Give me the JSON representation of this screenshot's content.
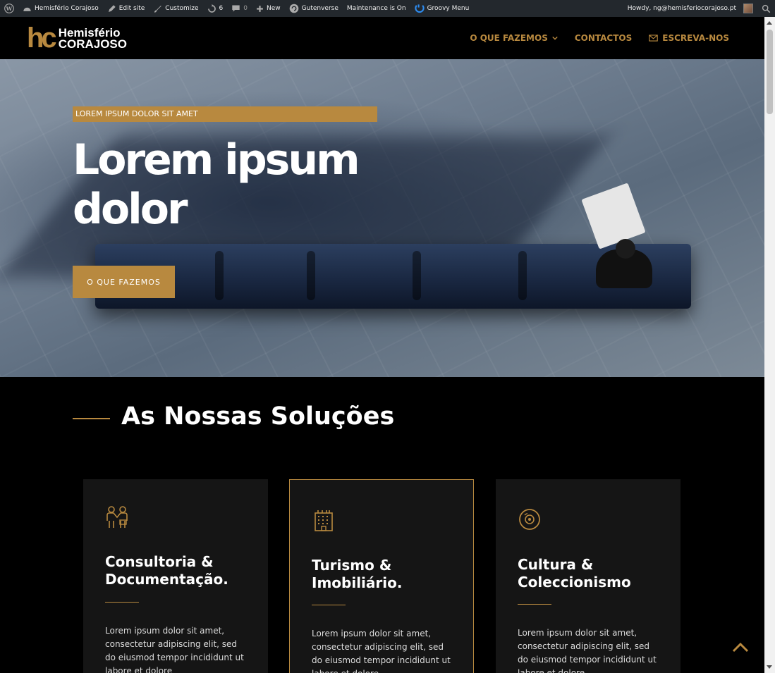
{
  "adminbar": {
    "site_name": "Hemisfério Corajoso",
    "edit_site": "Edit site",
    "customize": "Customize",
    "updates_count": "6",
    "comments_count": "0",
    "new": "New",
    "gutenverse": "Gutenverse",
    "maintenance": "Maintenance is On",
    "groovy": "Groovy Menu",
    "howdy": "Howdy, ng@hemisferiocorajoso.pt"
  },
  "header": {
    "logo_mark": "hc",
    "logo_line1": "Hemisfério",
    "logo_line2": "CORAJOSO",
    "nav": [
      {
        "label": "O QUE FAZEMOS"
      },
      {
        "label": "CONTACTOS"
      },
      {
        "label": "ESCREVA-NOS"
      }
    ]
  },
  "hero": {
    "badge": "LOREM IPSUM DOLOR SIT AMET",
    "title": "Lorem ipsum dolor",
    "button": "O QUE FAZEMOS"
  },
  "section": {
    "title": "As Nossas Soluções",
    "cards": [
      {
        "icon": "handshake-people-icon",
        "title": "Consultoria & Documentação.",
        "text": "Lorem ipsum dolor sit amet, consectetur adipiscing elit, sed do eiusmod tempor incididunt ut labore et dolore"
      },
      {
        "icon": "building-icon",
        "title": "Turismo & Imobiliário.",
        "text": "Lorem ipsum dolor sit amet, consectetur adipiscing elit, sed do eiusmod tempor incididunt ut labore et dolore"
      },
      {
        "icon": "vinyl-disc-icon",
        "title": "Cultura & Coleccionismo",
        "text": "Lorem ipsum dolor sit amet, consectetur adipiscing elit, sed do eiusmod tempor incididunt ut labore et dolore"
      }
    ]
  },
  "colors": {
    "accent": "#b8893f",
    "admin_bar": "#23282d",
    "card_bg": "#151515"
  }
}
